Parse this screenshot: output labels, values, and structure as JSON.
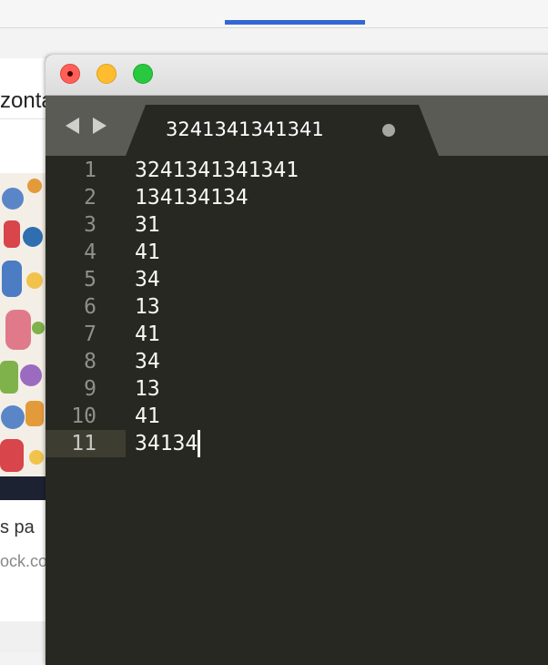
{
  "background_page": {
    "heading_fragment": "zonta",
    "caption_fragment": "s pa",
    "source_fragment": "ock.co"
  },
  "editor": {
    "tab": {
      "title": "3241341341341",
      "dirty": true
    },
    "lines": [
      {
        "number": "1",
        "text": "3241341341341"
      },
      {
        "number": "2",
        "text": "134134134"
      },
      {
        "number": "3",
        "text": "31"
      },
      {
        "number": "4",
        "text": "41"
      },
      {
        "number": "5",
        "text": "34"
      },
      {
        "number": "6",
        "text": "13"
      },
      {
        "number": "7",
        "text": "41"
      },
      {
        "number": "8",
        "text": "34"
      },
      {
        "number": "9",
        "text": "13"
      },
      {
        "number": "10",
        "text": "41"
      },
      {
        "number": "11",
        "text": "34134"
      }
    ],
    "current_line": 11
  },
  "colors": {
    "editor_background": "#272822",
    "editor_text": "#f8f8f2",
    "tabbar_background": "#5a5b55",
    "browser_accent": "#3467d4"
  },
  "icons": [
    "close-window-icon",
    "minimize-window-icon",
    "zoom-window-icon",
    "back-arrow-icon",
    "forward-arrow-icon",
    "unsaved-dot-icon"
  ]
}
